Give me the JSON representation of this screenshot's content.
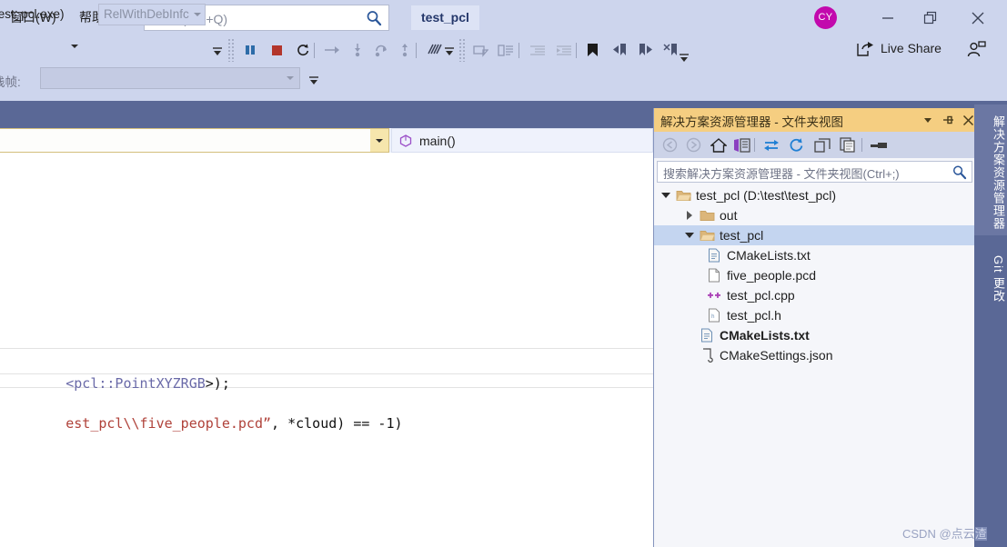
{
  "titlebar": {
    "menu": [
      {
        "name": "window-menu",
        "label": "窗口(W)"
      },
      {
        "name": "help-menu",
        "label": "帮助(H)"
      }
    ],
    "quick_search_placeholder": "搜索 (Ctrl+Q)",
    "quick_search_value": "",
    "search_icon": "search-icon",
    "document_tab": "test_pcl",
    "avatar_initials": "CY",
    "avatar_color": "#c209ad",
    "minimize_label": "—",
    "maximize_label": "❐",
    "close_label": "✕"
  },
  "toolbar": {
    "startup_project": "test_pcl.exe)",
    "configuration": "RelWithDebInfc",
    "buttons": [
      {
        "name": "pause-button",
        "icon": "pause-icon",
        "title": "全部中断"
      },
      {
        "name": "stop-button",
        "icon": "stop-icon",
        "title": "停止调试"
      },
      {
        "name": "restart-button",
        "icon": "restart-icon",
        "title": "重新启动"
      },
      {
        "name": "show-next-statement-button",
        "icon": "arrow-right-icon"
      },
      {
        "name": "step-into-button",
        "icon": "step-into-icon"
      },
      {
        "name": "step-over-button",
        "icon": "step-over-icon"
      },
      {
        "name": "step-out-button",
        "icon": "step-out-icon"
      },
      {
        "name": "hot-reload-button",
        "icon": "hot-reload-icon"
      },
      {
        "name": "comment-button",
        "icon": "comment-icon"
      },
      {
        "name": "uncomment-button",
        "icon": "uncomment-icon"
      },
      {
        "name": "decrease-indent-button",
        "icon": "outdent-icon"
      },
      {
        "name": "increase-indent-button",
        "icon": "indent-icon"
      },
      {
        "name": "toggle-bookmark-button",
        "icon": "bookmark-icon"
      },
      {
        "name": "previous-bookmark-button",
        "icon": "bookmark-prev-icon"
      },
      {
        "name": "next-bookmark-button",
        "icon": "bookmark-next-icon"
      },
      {
        "name": "clear-bookmarks-button",
        "icon": "bookmark-clear-icon"
      }
    ],
    "live_share_label": "Live Share",
    "live_share_icon": "live-share-icon",
    "add_collaborator_icon": "add-user-icon",
    "stack_frame_label": "栈帧:",
    "stack_frame_value": ""
  },
  "editor": {
    "scope_selector_value": "",
    "member_symbol_icon": "method-icon",
    "member_selector_value": "main()",
    "code_lines": [
      {
        "name": "code-line-cloud-decl",
        "tokens": [
          {
            "text": "<pcl::PointXYZRGB",
            "cls": "tok-ang"
          },
          {
            "text": ">);",
            "cls": "tok-black"
          }
        ]
      },
      {
        "name": "code-line-load-pcd",
        "tokens": [
          {
            "text": "est_pcl\\\\five_people.pcd”",
            "cls": "tok-dred"
          },
          {
            "text": ", *cloud) == -1)",
            "cls": "tok-black"
          }
        ]
      }
    ],
    "code_line_1_text": "<pcl::PointXYZRGB>);",
    "code_line_2_text": "est_pcl\\\\five_people.pcd”, *cloud) == -1)"
  },
  "solution_explorer": {
    "title": "解决方案资源管理器 - 文件夹视图",
    "header_buttons": [
      {
        "name": "window-dropdown-button",
        "icon": "chevron-down-icon"
      },
      {
        "name": "pin-button",
        "icon": "pin-icon"
      },
      {
        "name": "close-panel-button",
        "icon": "close-icon"
      }
    ],
    "toolbar_buttons": [
      {
        "name": "back-button",
        "icon": "back-arrow-icon"
      },
      {
        "name": "forward-button",
        "icon": "forward-arrow-icon"
      },
      {
        "name": "home-button",
        "icon": "home-icon"
      },
      {
        "name": "switch-views-button",
        "icon": "switch-views-icon"
      },
      {
        "name": "sync-with-active-document-button",
        "icon": "sync-icon"
      },
      {
        "name": "refresh-button",
        "icon": "refresh-icon"
      },
      {
        "name": "collapse-all-button",
        "icon": "collapse-all-icon"
      },
      {
        "name": "show-all-files-button",
        "icon": "show-all-files-icon"
      },
      {
        "name": "properties-button",
        "icon": "properties-icon"
      }
    ],
    "search_placeholder": "搜索解决方案资源管理器 - 文件夹视图(Ctrl+;)",
    "search_value": "",
    "search_icon": "search-icon",
    "tree": [
      {
        "name": "tree-item-root",
        "label": "test_pcl (D:\\test\\test_pcl)",
        "icon": "folder-open-icon",
        "twisty": "expanded",
        "indent": 1,
        "selected": false,
        "bold": false
      },
      {
        "name": "tree-item-out",
        "label": "out",
        "icon": "folder-icon",
        "twisty": "collapsed",
        "indent": 2,
        "selected": false,
        "bold": false
      },
      {
        "name": "tree-item-test-pcl-folder",
        "label": "test_pcl",
        "icon": "folder-open-icon",
        "twisty": "expanded",
        "indent": 2,
        "selected": true,
        "bold": false,
        "annotated": true
      },
      {
        "name": "tree-item-cmakelists-inner",
        "label": "CMakeLists.txt",
        "icon": "text-file-icon",
        "twisty": "none",
        "indent": 3,
        "selected": false,
        "bold": false
      },
      {
        "name": "tree-item-five-people-pcd",
        "label": "five_people.pcd",
        "icon": "blank-file-icon",
        "twisty": "none",
        "indent": 3,
        "selected": false,
        "bold": false
      },
      {
        "name": "tree-item-test-pcl-cpp",
        "label": "test_pcl.cpp",
        "icon": "cpp-file-icon",
        "twisty": "none",
        "indent": 3,
        "selected": false,
        "bold": false
      },
      {
        "name": "tree-item-test-pcl-h",
        "label": "test_pcl.h",
        "icon": "header-file-icon",
        "twisty": "none",
        "indent": 3,
        "selected": false,
        "bold": false
      },
      {
        "name": "tree-item-cmakelists-root",
        "label": "CMakeLists.txt",
        "icon": "text-file-icon",
        "twisty": "none",
        "indent": 4,
        "selected": false,
        "bold": true
      },
      {
        "name": "tree-item-cmakesettings-json",
        "label": "CMakeSettings.json",
        "icon": "json-file-icon",
        "twisty": "none",
        "indent": 4,
        "selected": false,
        "bold": false
      }
    ],
    "annotation_color": "#e01a1a"
  },
  "side_tabs": [
    {
      "name": "vtab-solution-explorer",
      "label": "解决方案资源管理器",
      "active": true
    },
    {
      "name": "vtab-git-changes",
      "label": "Git 更改",
      "active": false
    }
  ],
  "watermark": {
    "prefix": "CSDN @点云",
    "highlight": "渣"
  },
  "colors": {
    "chrome": "#cdd5ed",
    "accent_band": "#5a6896",
    "panel_header": "#f5ce81",
    "selection": "#c4d5f0",
    "annotation": "#e01a1a"
  }
}
